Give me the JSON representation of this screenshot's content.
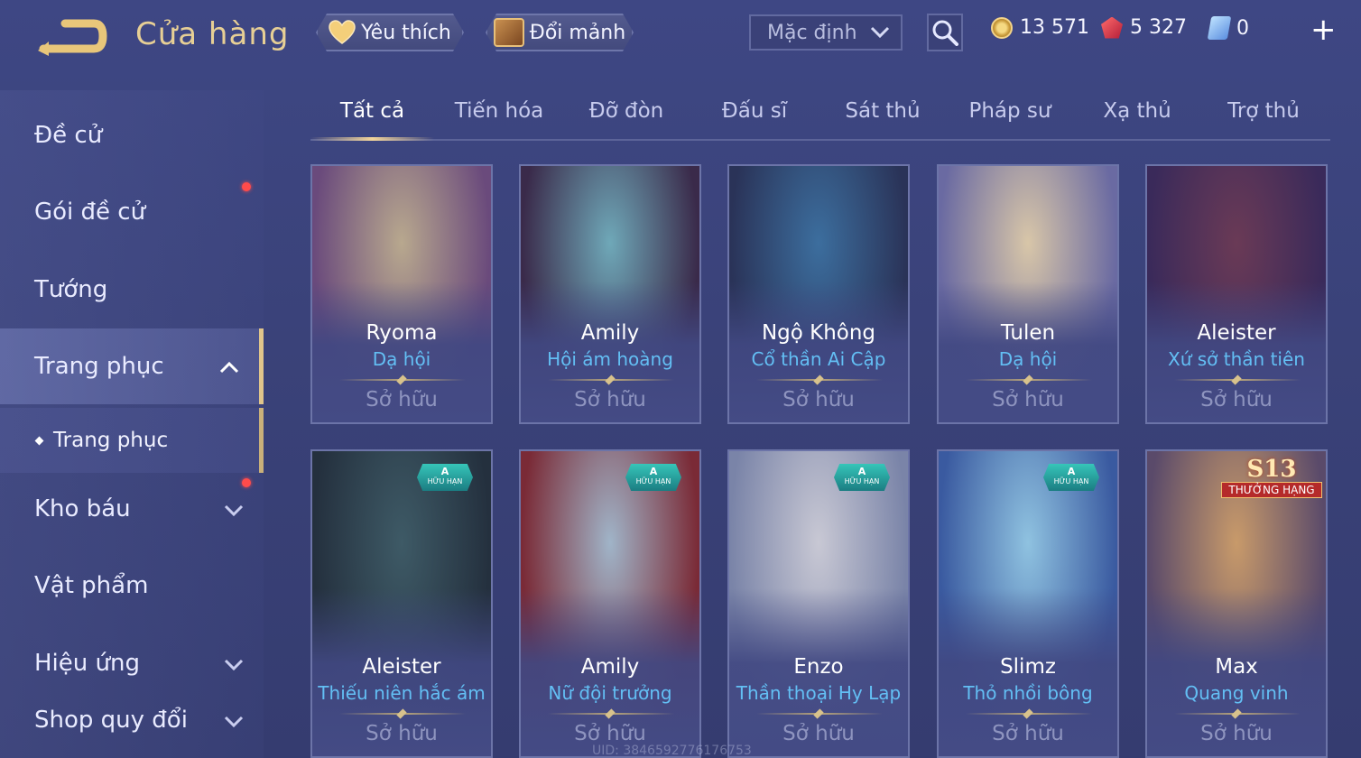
{
  "header": {
    "title": "Cửa hàng",
    "favorite_label": "Yêu thích",
    "shard_label": "Đổi mảnh",
    "sort_value": "Mặc định",
    "currencies": {
      "gold": "13 571",
      "ruby": "5 327",
      "ticket": "0"
    },
    "plus_label": "+"
  },
  "sidebar": {
    "items": [
      {
        "label": "Đề cử"
      },
      {
        "label": "Gói đề cử"
      },
      {
        "label": "Tướng"
      },
      {
        "label": "Trang phục"
      },
      {
        "label": "Kho báu"
      },
      {
        "label": "Vật phẩm"
      },
      {
        "label": "Hiệu ứng"
      },
      {
        "label": "Shop quy đổi"
      }
    ],
    "sub_item": "Trang phục"
  },
  "tabs": [
    "Tất cả",
    "Tiến hóa",
    "Đỡ đòn",
    "Đấu sĩ",
    "Sát thủ",
    "Pháp sư",
    "Xạ thủ",
    "Trợ thủ"
  ],
  "cards": [
    {
      "hero": "Ryoma",
      "skin": "Dạ hội",
      "status": "Sở hữu",
      "palette": [
        "#b8a88e",
        "#6a4a7c"
      ]
    },
    {
      "hero": "Amily",
      "skin": "Hội ám hoàng",
      "status": "Sở hữu",
      "palette": [
        "#6fa8b8",
        "#3a2a4a"
      ]
    },
    {
      "hero": "Ngộ Không",
      "skin": "Cổ thần Ai Cập",
      "status": "Sở hữu",
      "palette": [
        "#3c6e9e",
        "#2a3358"
      ]
    },
    {
      "hero": "Tulen",
      "skin": "Dạ hội",
      "status": "Sở hữu",
      "palette": [
        "#d8c6a8",
        "#6a6aa2"
      ]
    },
    {
      "hero": "Aleister",
      "skin": "Xứ sở thần tiên",
      "status": "Sở hữu",
      "palette": [
        "#6a3a56",
        "#3a2a5a"
      ]
    },
    {
      "hero": "Aleister",
      "skin": "Thiếu niên hắc ám",
      "status": "Sở hữu",
      "badge": {
        "tier": "A",
        "label": "HỮU HẠN"
      },
      "palette": [
        "#3e5a66",
        "#24303e"
      ]
    },
    {
      "hero": "Amily",
      "skin": "Nữ đội trưởng",
      "status": "Sở hữu",
      "badge": {
        "tier": "A",
        "label": "HỮU HẠN"
      },
      "palette": [
        "#a0b4c8",
        "#7a2a36"
      ]
    },
    {
      "hero": "Enzo",
      "skin": "Thần thoại Hy Lạp",
      "status": "Sở hữu",
      "badge": {
        "tier": "A",
        "label": "HỮU HẠN"
      },
      "palette": [
        "#c8c8d4",
        "#7a84a8"
      ]
    },
    {
      "hero": "Slimz",
      "skin": "Thỏ nhồi bông",
      "status": "Sở hữu",
      "badge": {
        "tier": "A",
        "label": "HỮU HẠN"
      },
      "palette": [
        "#8fc2e0",
        "#3a5aa0"
      ]
    },
    {
      "hero": "Max",
      "skin": "Quang vinh",
      "status": "Sở hữu",
      "badge_s13": {
        "season": "S13",
        "label": "THƯỞNG HẠNG"
      },
      "palette": [
        "#c89a6a",
        "#5a4a6a"
      ]
    }
  ],
  "uid_text": "UID: 3846592776176753"
}
